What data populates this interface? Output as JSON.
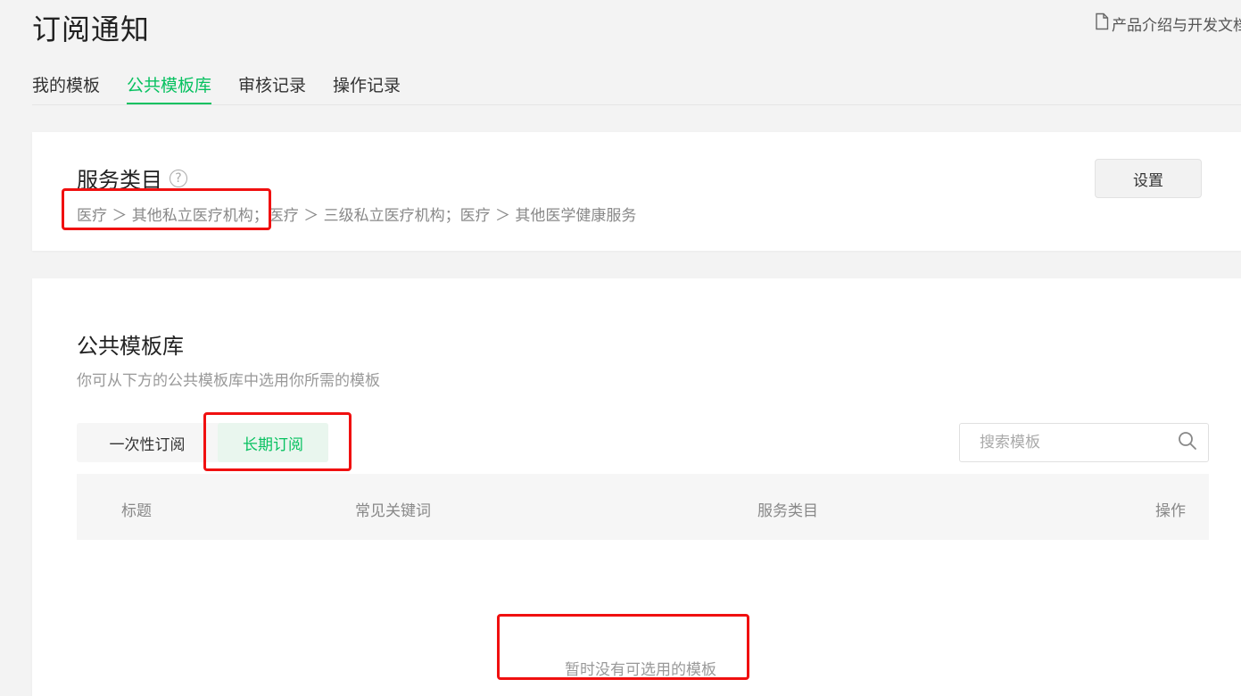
{
  "header": {
    "title": "订阅通知",
    "doc_link": "产品介绍与开发文档"
  },
  "tabs": [
    {
      "label": "我的模板",
      "active": false
    },
    {
      "label": "公共模板库",
      "active": true
    },
    {
      "label": "审核记录",
      "active": false
    },
    {
      "label": "操作记录",
      "active": false
    }
  ],
  "service_category": {
    "title": "服务类目",
    "help_icon": "question-circle-icon",
    "path": "医疗 ＞ 其他私立医疗机构；医疗 ＞ 三级私立医疗机构；医疗 ＞ 其他医学健康服务",
    "settings_label": "设置"
  },
  "library": {
    "title": "公共模板库",
    "description": "你可从下方的公共模板库中选用你所需的模板",
    "sub_tabs": [
      {
        "label": "一次性订阅",
        "active": false
      },
      {
        "label": "长期订阅",
        "active": true
      }
    ],
    "search": {
      "placeholder": "搜索模板",
      "value": ""
    },
    "table_headers": [
      "标题",
      "常见关键词",
      "服务类目",
      "操作"
    ],
    "empty_text": "暂时没有可选用的模板"
  },
  "colors": {
    "accent": "#07c160",
    "annotation": "#f01010"
  }
}
